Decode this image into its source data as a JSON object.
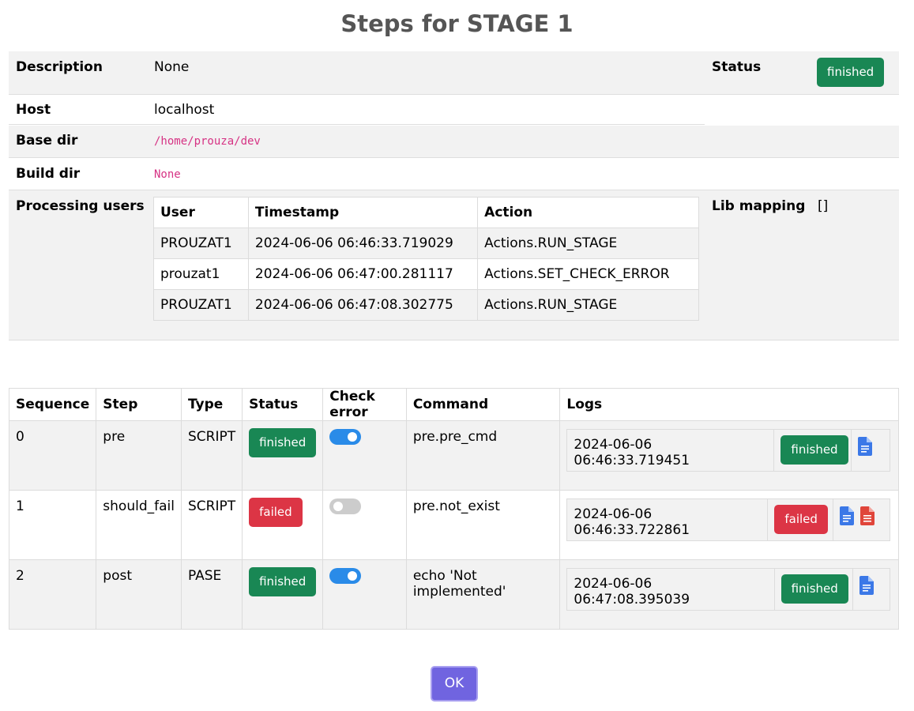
{
  "title": "Steps for STAGE 1",
  "info": {
    "description_label": "Description",
    "description_value": "None",
    "status_label": "Status",
    "status_value": "finished",
    "host_label": "Host",
    "host_value": "localhost",
    "basedir_label": "Base dir",
    "basedir_value": "/home/prouza/dev",
    "builddir_label": "Build dir",
    "builddir_value": "None",
    "users_label": "Processing users",
    "libmap_label": "Lib mapping",
    "libmap_value": "[]"
  },
  "users_table": {
    "headers": [
      "User",
      "Timestamp",
      "Action"
    ],
    "rows": [
      [
        "PROUZAT1",
        "2024-06-06 06:46:33.719029",
        "Actions.RUN_STAGE"
      ],
      [
        "prouzat1",
        "2024-06-06 06:47:00.281117",
        "Actions.SET_CHECK_ERROR"
      ],
      [
        "PROUZAT1",
        "2024-06-06 06:47:08.302775",
        "Actions.RUN_STAGE"
      ]
    ]
  },
  "steps_table": {
    "headers": [
      "Sequence",
      "Step",
      "Type",
      "Status",
      "Check error",
      "Command",
      "Logs"
    ],
    "rows": [
      {
        "seq": "0",
        "step": "pre",
        "type": "SCRIPT",
        "status": "finished",
        "check_error": true,
        "command": "pre.pre_cmd",
        "log_ts": "2024-06-06 06:46:33.719451",
        "log_status": "finished",
        "icons": [
          "document-icon"
        ]
      },
      {
        "seq": "1",
        "step": "should_fail",
        "type": "SCRIPT",
        "status": "failed",
        "check_error": false,
        "command": "pre.not_exist",
        "log_ts": "2024-06-06 06:46:33.722861",
        "log_status": "failed",
        "icons": [
          "document-icon",
          "error-document-icon"
        ]
      },
      {
        "seq": "2",
        "step": "post",
        "type": "PASE",
        "status": "finished",
        "check_error": true,
        "command": "echo 'Not implemented'",
        "log_ts": "2024-06-06 06:47:08.395039",
        "log_status": "finished",
        "icons": [
          "document-icon"
        ]
      }
    ]
  },
  "ok_label": "OK",
  "colors": {
    "finished": "#198754",
    "failed": "#dc3545",
    "toggle_on": "#2a8be8",
    "ok_button": "#7064e0"
  }
}
